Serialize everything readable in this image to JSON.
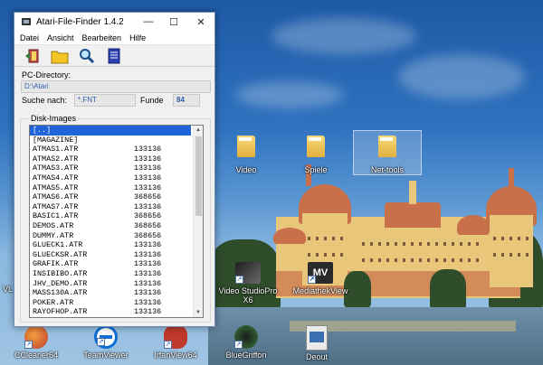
{
  "window": {
    "title": "Atari-File-Finder 1.4.2",
    "minimize_glyph": "—",
    "maximize_glyph": "☐",
    "close_glyph": "✕",
    "menu": [
      "Datei",
      "Ansicht",
      "Bearbeiten",
      "Hilfe"
    ],
    "toolbar": [
      "exit-icon",
      "open-folder-icon",
      "search-icon",
      "document-icon"
    ],
    "pc_directory_label": "PC-Directory:",
    "pc_directory_value": "D:\\Atari",
    "search_label": "Suche nach:",
    "search_value": "*.FNT",
    "hits_label": "Funde",
    "hits_value": "84",
    "disk_images_label": "Disk-Images",
    "files": [
      {
        "name": "[..]",
        "size": ""
      },
      {
        "name": "[MAGAZINE]",
        "size": ""
      },
      {
        "name": "ATMAS1.ATR",
        "size": "133136"
      },
      {
        "name": "ATMAS2.ATR",
        "size": "133136"
      },
      {
        "name": "ATMAS3.ATR",
        "size": "133136"
      },
      {
        "name": "ATMAS4.ATR",
        "size": "133136"
      },
      {
        "name": "ATMAS5.ATR",
        "size": "133136"
      },
      {
        "name": "ATMAS6.ATR",
        "size": "368656"
      },
      {
        "name": "ATMAS7.ATR",
        "size": "133136"
      },
      {
        "name": "BASIC1.ATR",
        "size": "368656"
      },
      {
        "name": "DEMOS.ATR",
        "size": "368656"
      },
      {
        "name": "DUMMY.ATR",
        "size": "368656"
      },
      {
        "name": "GLUECK1.ATR",
        "size": "133136"
      },
      {
        "name": "GLUECKSR.ATR",
        "size": "133136"
      },
      {
        "name": "GRAFIK.ATR",
        "size": "133136"
      },
      {
        "name": "INSIBIBO.ATR",
        "size": "133136"
      },
      {
        "name": "JHV_DEMO.ATR",
        "size": "133136"
      },
      {
        "name": "MASS130A.ATR",
        "size": "133136"
      },
      {
        "name": "POKER.ATR",
        "size": "133136"
      },
      {
        "name": "RAYOFHOP.ATR",
        "size": "133136"
      }
    ],
    "selected_index": 0
  },
  "desktop": {
    "icons": [
      {
        "label": "Video",
        "icon": "folder-icon"
      },
      {
        "label": "Spiele",
        "icon": "folder-icon"
      },
      {
        "label": "Net-tools",
        "icon": "folder-icon"
      },
      {
        "label": "Video StudioPro X6",
        "icon": "video-studio-icon"
      },
      {
        "label": "MediathekView",
        "icon": "mediathek-icon"
      },
      {
        "label": "VL",
        "icon": "vlc-icon"
      }
    ],
    "bottom_icons": [
      {
        "label": "CCleaner64",
        "icon": "ccleaner-icon"
      },
      {
        "label": "TeamViewer",
        "icon": "teamviewer-icon"
      },
      {
        "label": "IrfanView64",
        "icon": "irfanview-icon"
      },
      {
        "label": "BlueGriffon",
        "icon": "bluegriffon-icon"
      },
      {
        "label": "Deout",
        "icon": "video-file-icon"
      }
    ]
  },
  "colors": {
    "selection": "#1f64d8",
    "field_text": "#2b5ea8"
  }
}
